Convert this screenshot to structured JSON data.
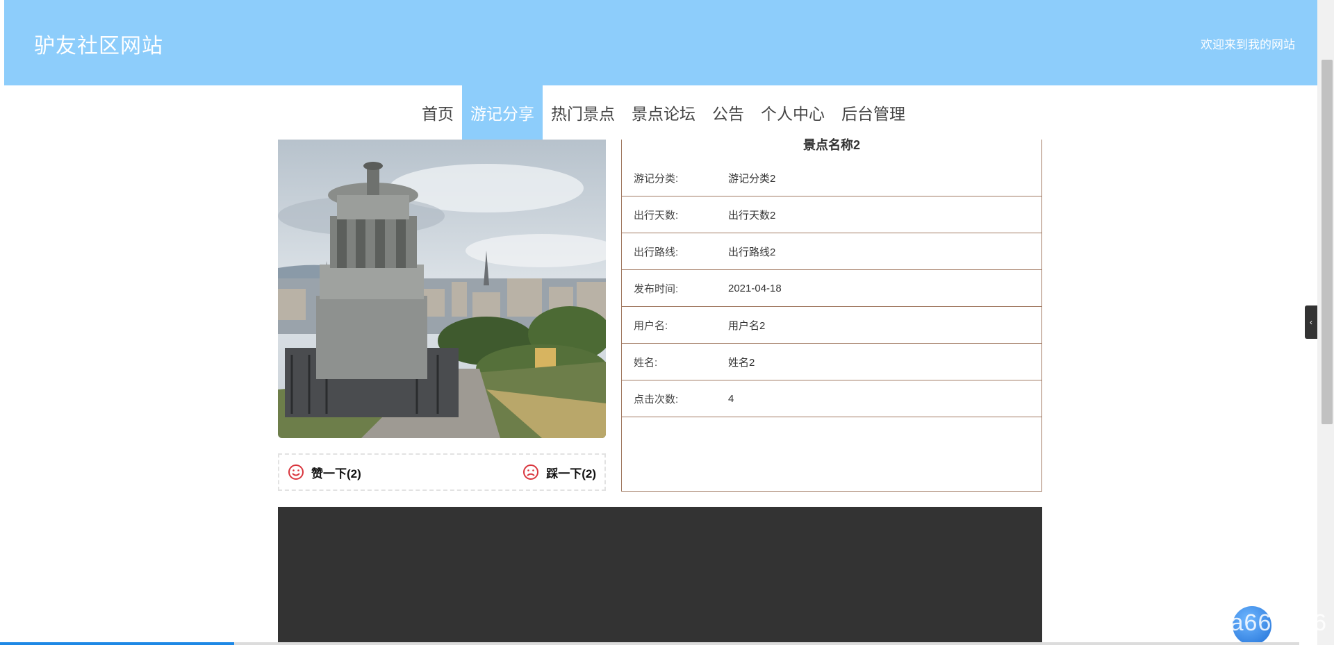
{
  "header": {
    "site_title": "驴友社区网站",
    "welcome": "欢迎来到我的网站"
  },
  "nav": {
    "items": [
      {
        "label": "首页"
      },
      {
        "label": "游记分享",
        "active": true
      },
      {
        "label": "热门景点"
      },
      {
        "label": "景点论坛"
      },
      {
        "label": "公告"
      },
      {
        "label": "个人中心"
      },
      {
        "label": "后台管理"
      }
    ]
  },
  "vote": {
    "like_label": "赞一下(2)",
    "dislike_label": "踩一下(2)"
  },
  "detail": {
    "title": "景点名称2",
    "rows": [
      {
        "key": "游记分类:",
        "value": "游记分类2"
      },
      {
        "key": "出行天数:",
        "value": "出行天数2"
      },
      {
        "key": "出行路线:",
        "value": "出行路线2"
      },
      {
        "key": "发布时间:",
        "value": "2021-04-18"
      },
      {
        "key": "用户名:",
        "value": "用户名2"
      },
      {
        "key": "姓名:",
        "value": "姓名2"
      },
      {
        "key": "点击次数:",
        "value": "4"
      }
    ]
  },
  "watermark": "CSDN @nodejava666666",
  "progress": 0.18,
  "colors": {
    "header_bg": "#8dcdfb",
    "table_border": "#a07860",
    "dark_block": "#333333",
    "vote_icon": "#d9363e"
  }
}
